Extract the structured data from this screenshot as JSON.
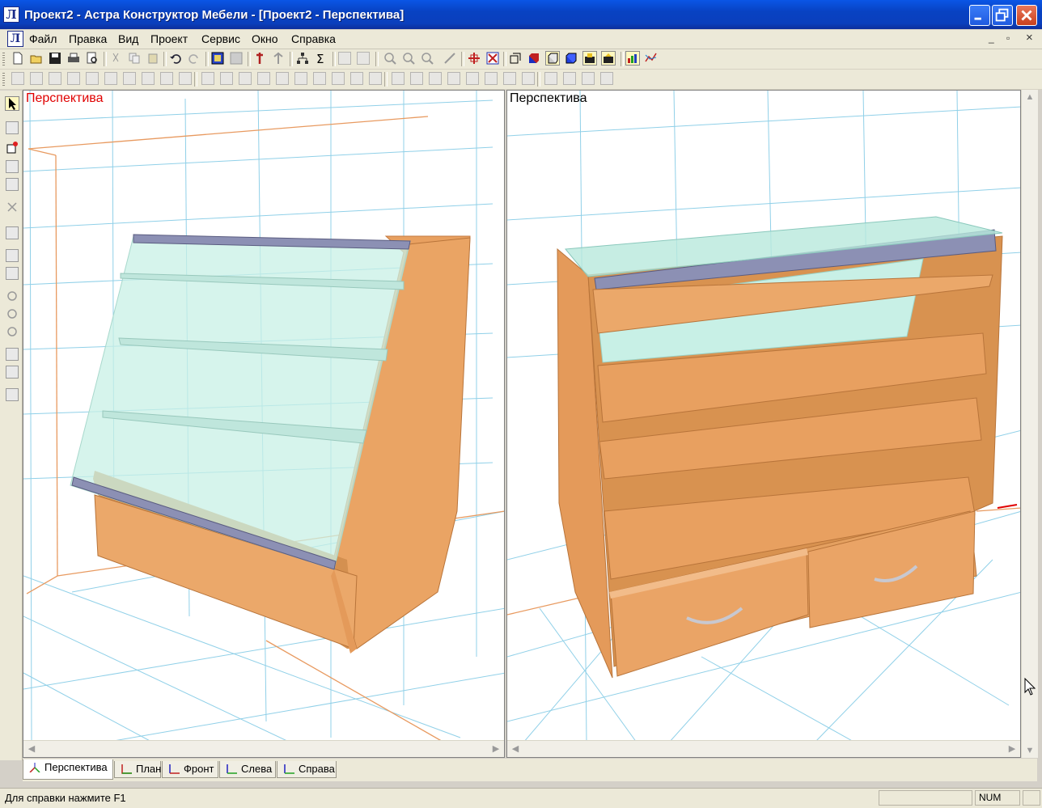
{
  "window": {
    "title": "Проект2 - Астра Конструктор Мебели - [Проект2 - Перспектива]",
    "app_icon_letter": "Л"
  },
  "menu": {
    "items": [
      "Файл",
      "Правка",
      "Вид",
      "Проект",
      "Сервис",
      "Окно",
      "Справка"
    ],
    "mdi_minimize": "_",
    "mdi_restore": "▫",
    "mdi_close": "×"
  },
  "toolbar_icons": {
    "row1": [
      "new-file-icon",
      "open-folder-icon",
      "save-icon",
      "print-icon",
      "print-preview-icon",
      "cut-icon",
      "copy-icon",
      "paste-icon",
      "undo-icon",
      "redo-icon",
      "select-all-icon",
      "hatch-icon",
      "import-icon",
      "export-icon",
      "tree-icon",
      "sum-icon",
      "frame-icon",
      "frame2-icon",
      "zoom-in-icon",
      "zoom-out-icon",
      "zoom-fit-icon",
      "measure-icon",
      "snap-icon",
      "delete-icon",
      "view-wire-icon",
      "view-solid-icon",
      "view-shaded-icon",
      "view-texture-icon",
      "view-scene-icon",
      "view-photo-icon",
      "chart-icon",
      "graph-icon"
    ],
    "row2_count": 44
  },
  "viewports": {
    "left": {
      "label": "Перспектива",
      "label_color": "#e00000"
    },
    "right": {
      "label": "Перспектива",
      "label_color": "#000000"
    }
  },
  "tabs": [
    {
      "label": "Перспектива",
      "active": true
    },
    {
      "label": "План",
      "active": false
    },
    {
      "label": "Фронт",
      "active": false
    },
    {
      "label": "Слева",
      "active": false
    },
    {
      "label": "Справа",
      "active": false
    }
  ],
  "status": {
    "help_text": "Для справки нажмите F1",
    "num": "NUM"
  },
  "colors": {
    "wood": "#e8a060",
    "glass": "#bfeee0",
    "grid": "#8fd0e6",
    "room_edge": "#e89a60"
  }
}
